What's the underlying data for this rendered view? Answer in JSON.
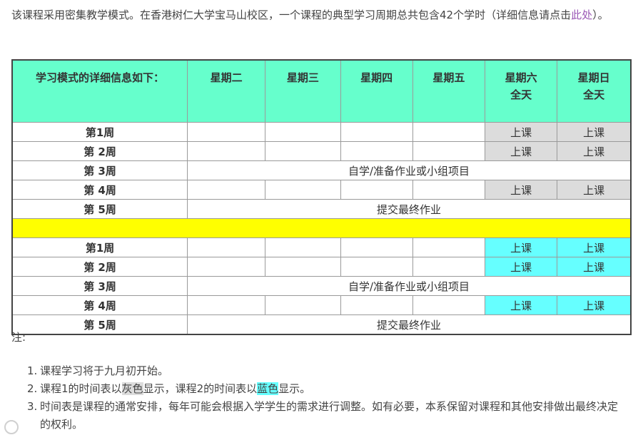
{
  "intro": {
    "text": "该课程采用密集教学模式。在香港树仁大学宝马山校区，一个课程的典型学习周期总共包含42个学时（详细信息请点击",
    "link": "此处",
    "suffix": "）。"
  },
  "table": {
    "header": {
      "col0": "学习模式的详细信息如下：",
      "col1": "星期二",
      "col2": "星期三",
      "col3": "星期四",
      "col4": "星期五",
      "col5_line1": "星期六",
      "col5_line2": "全天",
      "col6_line1": "星期日",
      "col6_line2": "全天"
    },
    "course1": {
      "week1": "第1周",
      "week2": "第 2周",
      "week3": "第 3周",
      "week4": "第 4周",
      "week5": "第 5周",
      "class": "上课",
      "self_study": "自学/准备作业或小组项目",
      "final": "提交最终作业"
    },
    "course2": {
      "week1": "第1周",
      "week2": "第 2周",
      "week3": "第 3周",
      "week4": "第 4周",
      "week5": "第 5周",
      "class": "上课",
      "self_study": "自学/准备作业或小组项目",
      "final": "提交最终作业"
    }
  },
  "notes": {
    "label": "注:",
    "items": [
      {
        "num": "1.",
        "text": "课程学习将于九月初开始。"
      },
      {
        "num": "2.",
        "pre": "课程1的时间表以",
        "gray": "灰色",
        "mid": "显示，课程2的时间表以",
        "cyan": "蓝色",
        "post": "显示。"
      },
      {
        "num": "3.",
        "text": "时间表是课程的通常安排，每年可能会根据入学学生的需求进行调整。如有必要，本系保留对课程和其他安排做出最终决定的权利。"
      }
    ]
  },
  "colors": {
    "header_bg": "#66ffcc",
    "course1_class": "#dcdcdc",
    "course2_class": "#66ffff",
    "separator": "#ffff00",
    "link": "#9b59b6"
  }
}
